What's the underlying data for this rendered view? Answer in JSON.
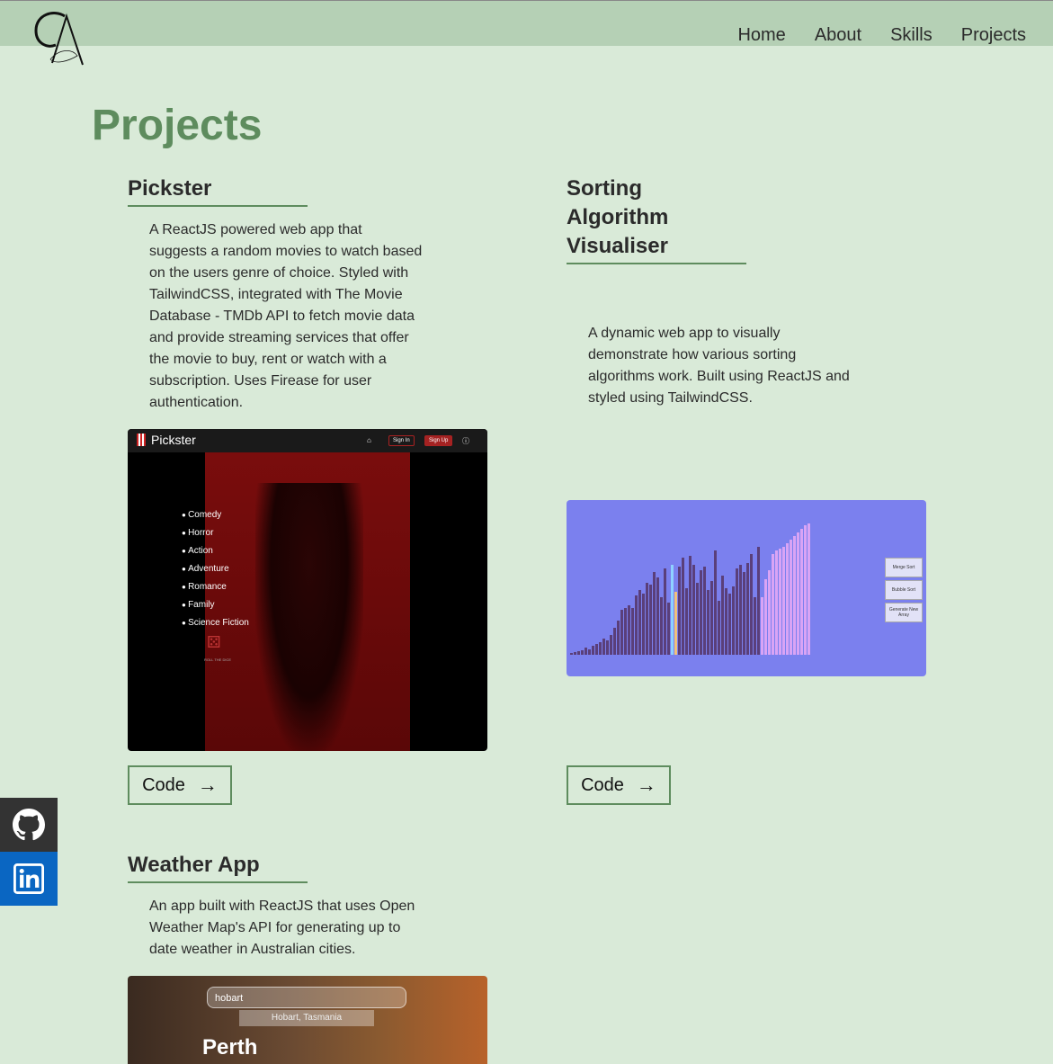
{
  "nav": {
    "items": [
      "Home",
      "About",
      "Skills",
      "Projects"
    ]
  },
  "page_title": "Projects",
  "projects": [
    {
      "title": "Pickster",
      "description": "A ReactJS powered web app that suggests a random movies to watch based on the users genre of choice. Styled with TailwindCSS, integrated with The Movie Database - TMDb API to fetch movie data and provide streaming services that offer the movie to buy, rent or watch with a subscription. Uses Firease for user authentication.",
      "button": "Code",
      "screenshot": {
        "brand": "Pickster",
        "sign_in": "Sign In",
        "sign_up": "Sign Up",
        "genres": [
          "Comedy",
          "Horror",
          "Action",
          "Adventure",
          "Romance",
          "Family",
          "Science Fiction"
        ],
        "roll": "ROLL THE DICE"
      }
    },
    {
      "title": "Sorting Algorithm Visualiser",
      "description": "A dynamic web app to visually demonstrate how various sorting algorithms work. Built using ReactJS and styled using TailwindCSS.",
      "button": "Code",
      "screenshot": {
        "buttons": [
          "Merge Sort",
          "Bubble Sort",
          "Generate New Array"
        ]
      }
    },
    {
      "title": "Weather App",
      "description": "An app built with ReactJS that uses Open Weather Map's API for generating up to date weather in Australian cities.",
      "screenshot": {
        "search_value": "hobart",
        "suggestion": "Hobart, Tasmania",
        "city": "Perth"
      }
    }
  ],
  "colors": {
    "accent": "#5e8c5e",
    "background": "#d9ead8",
    "header": "#b5d0b5",
    "github": "#333333",
    "linkedin": "#0a66c2"
  },
  "icons": {
    "github": "github-icon",
    "linkedin": "linkedin-icon",
    "arrow": "arrow-right-icon"
  }
}
